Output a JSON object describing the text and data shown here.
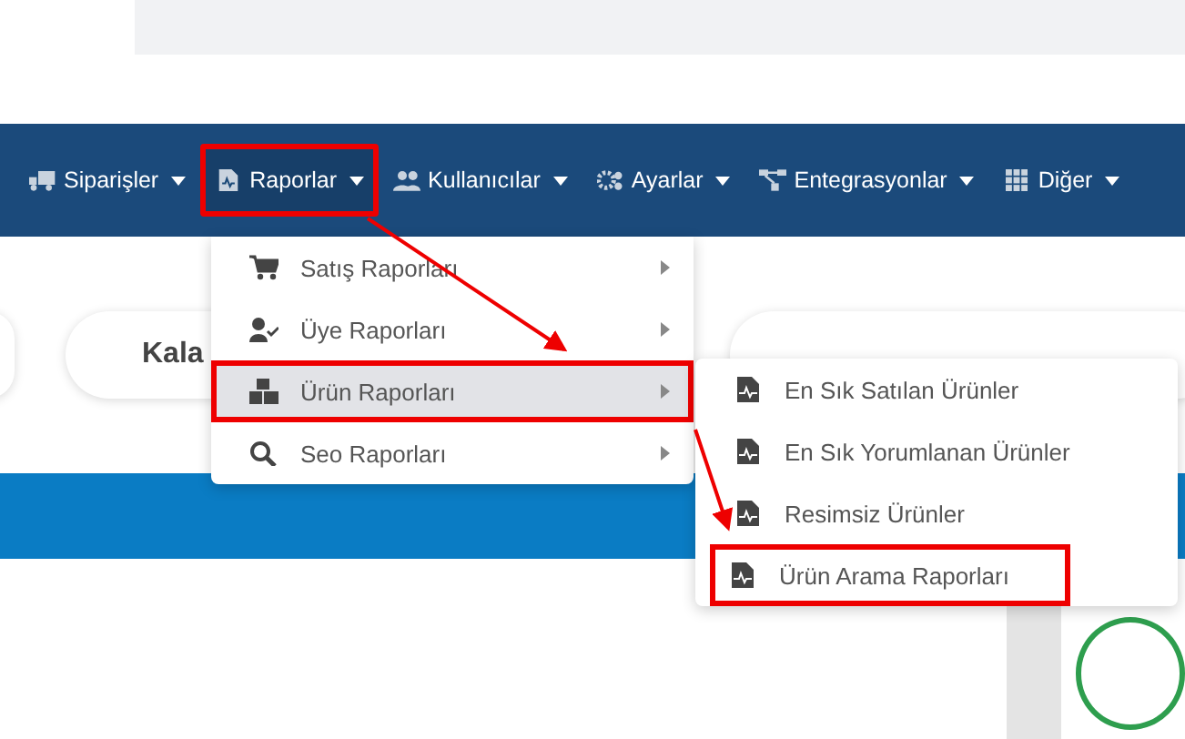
{
  "navbar": {
    "items": [
      {
        "label": "Siparişler",
        "selected": false,
        "annotated": false
      },
      {
        "label": "Raporlar",
        "selected": true,
        "annotated": true
      },
      {
        "label": "Kullanıcılar",
        "selected": false,
        "annotated": false
      },
      {
        "label": "Ayarlar",
        "selected": false,
        "annotated": false
      },
      {
        "label": "Entegrasyonlar",
        "selected": false,
        "annotated": false
      },
      {
        "label": "Diğer",
        "selected": false,
        "annotated": false
      }
    ]
  },
  "content": {
    "pill_label": "Kala"
  },
  "reports_menu": {
    "items": [
      {
        "label": "Satış Raporları",
        "selected": false,
        "annotated": false
      },
      {
        "label": "Üye Raporları",
        "selected": false,
        "annotated": false
      },
      {
        "label": "Ürün Raporları",
        "selected": true,
        "annotated": true
      },
      {
        "label": "Seo Raporları",
        "selected": false,
        "annotated": false
      }
    ]
  },
  "product_reports_menu": {
    "items": [
      {
        "label": "En Sık Satılan Ürünler",
        "annotated": false
      },
      {
        "label": "En Sık Yorumlanan Ürünler",
        "annotated": false
      },
      {
        "label": "Resimsiz Ürünler",
        "annotated": false
      },
      {
        "label": "Ürün Arama Raporları",
        "annotated": true
      }
    ]
  }
}
